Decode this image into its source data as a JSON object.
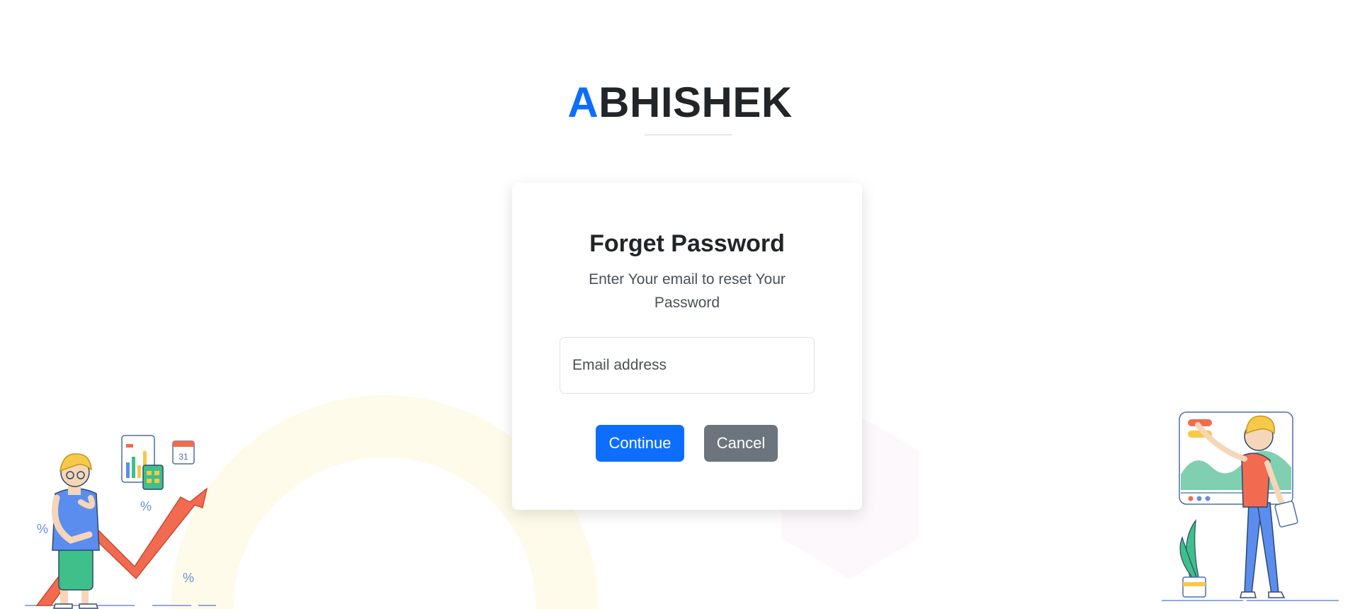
{
  "brand": {
    "first_letter": "A",
    "rest": "BHISHEK"
  },
  "card": {
    "title": "Forget Password",
    "subtitle": "Enter Your email to reset Your Password",
    "email_placeholder": "Email address",
    "continue_label": "Continue",
    "cancel_label": "Cancel"
  },
  "illustrations": {
    "left_percent_symbol": "%",
    "calendar_day": "31"
  },
  "colors": {
    "accent": "#0d6efd",
    "secondary": "#6c757d",
    "arrow": "#f26b50",
    "shirt_left": "#5b8def",
    "pants_left": "#3fbf8a",
    "shirt_right": "#f26b50",
    "hair": "#f7c948"
  }
}
